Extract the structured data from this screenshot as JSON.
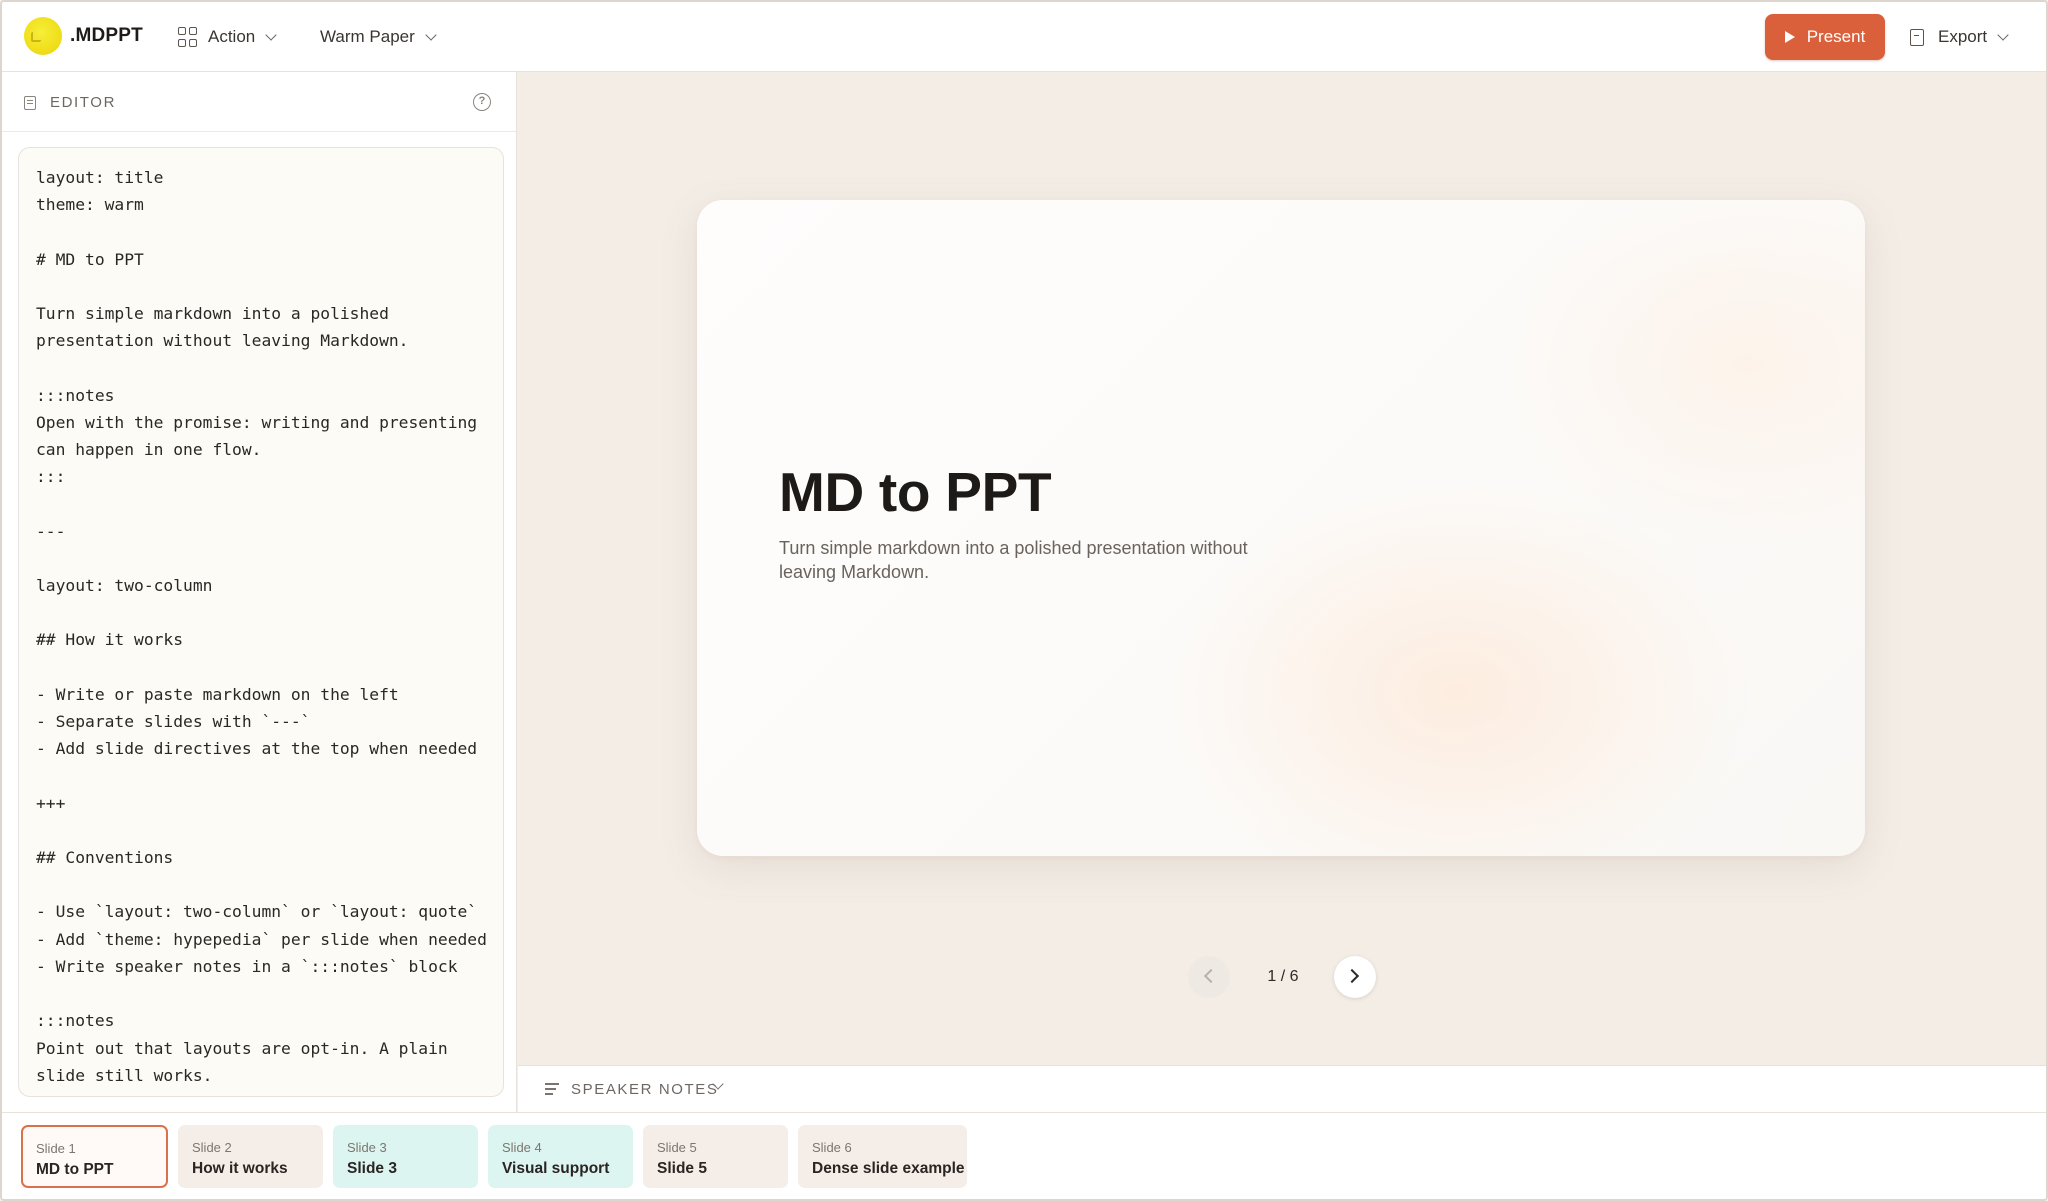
{
  "app": {
    "brand": ".MDPPT",
    "action_menu": "Action",
    "theme_menu": "Warm Paper",
    "present_label": "Present",
    "export_label": "Export",
    "accent_color": "#d9603a"
  },
  "editor": {
    "label": "EDITOR",
    "help_glyph": "?",
    "content": "layout: title\ntheme: warm\n\n# MD to PPT\n\nTurn simple markdown into a polished\npresentation without leaving Markdown.\n\n:::notes\nOpen with the promise: writing and presenting\ncan happen in one flow.\n:::\n\n---\n\nlayout: two-column\n\n## How it works\n\n- Write or paste markdown on the left\n- Separate slides with `---`\n- Add slide directives at the top when needed\n\n+++\n\n## Conventions\n\n- Use `layout: two-column` or `layout: quote`\n- Add `theme: hypepedia` per slide when needed\n- Write speaker notes in a `:::notes` block\n\n:::notes\nPoint out that layouts are opt-in. A plain\nslide still works."
  },
  "slide": {
    "title": "MD to PPT",
    "subtitle": "Turn simple markdown into a polished presentation without leaving Markdown."
  },
  "pager": {
    "current": 1,
    "total": 6,
    "label": "1 / 6"
  },
  "notes": {
    "label": "SPEAKER NOTES"
  },
  "thumbnails": [
    {
      "num": "Slide 1",
      "title": "MD to PPT",
      "bg": "#fffaf7",
      "active": true
    },
    {
      "num": "Slide 2",
      "title": "How it works",
      "bg": "#f5eee8",
      "active": false
    },
    {
      "num": "Slide 3",
      "title": "Slide 3",
      "bg": "#ddf5f1",
      "active": false
    },
    {
      "num": "Slide 4",
      "title": "Visual support",
      "bg": "#ddf5f1",
      "active": false
    },
    {
      "num": "Slide 5",
      "title": "Slide 5",
      "bg": "#f5eee8",
      "active": false
    },
    {
      "num": "Slide 6",
      "title": "Dense slide example",
      "bg": "#f5eee8",
      "active": false
    }
  ]
}
